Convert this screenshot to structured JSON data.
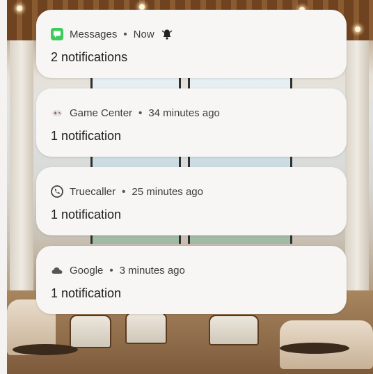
{
  "notifications": [
    {
      "app": "Messages",
      "time": "Now",
      "summary": "2 notifications",
      "icon": "messages-icon",
      "icon_color": "#3ecb5a",
      "alert_icon": "bell-alert-icon"
    },
    {
      "app": "Game Center",
      "time": "34 minutes ago",
      "summary": "1 notification",
      "icon": "game-controller-icon"
    },
    {
      "app": "Truecaller",
      "time": "25 minutes ago",
      "summary": "1 notification",
      "icon": "phone-call-icon"
    },
    {
      "app": "Google",
      "time": "3 minutes ago",
      "summary": "1 notification",
      "icon": "cloud-icon"
    }
  ],
  "separator": "•",
  "colors": {
    "card_bg": "#f7f6f5",
    "text_primary": "#1c1c1c",
    "text_secondary": "#3c3c3c",
    "messages_green": "#3ecb5a"
  }
}
